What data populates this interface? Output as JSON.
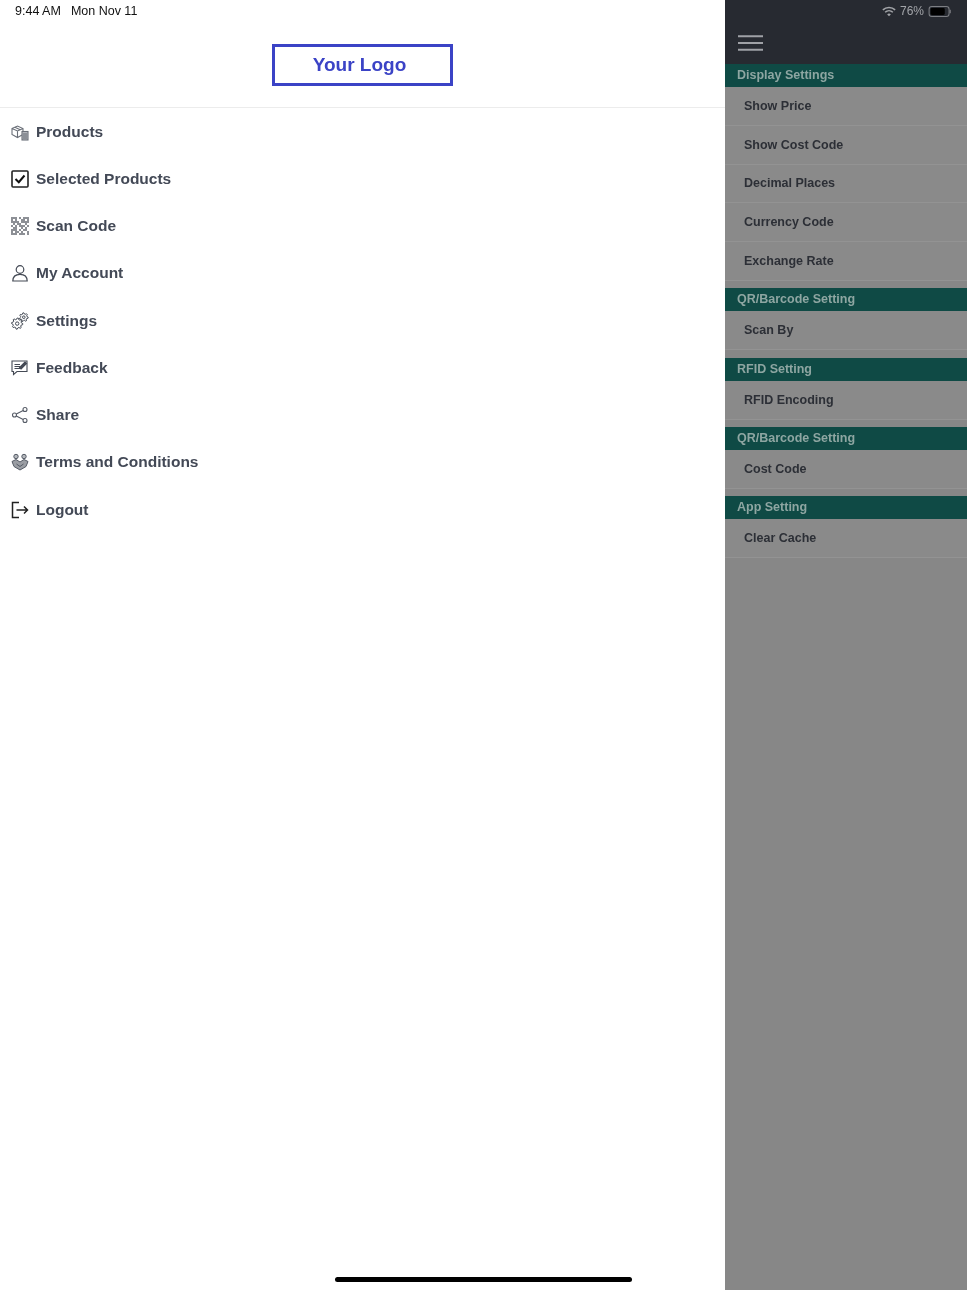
{
  "status_bar": {
    "time": "9:44 AM",
    "date": "Mon Nov 11",
    "battery": "76%"
  },
  "drawer": {
    "logo": "Your Logo",
    "items": [
      "Products",
      "Selected Products",
      "Scan Code",
      "My Account",
      "Settings",
      "Feedback",
      "Share",
      "Terms and Conditions",
      "Logout"
    ]
  },
  "settings_screen": {
    "sections": [
      {
        "title": "Display Settings",
        "items": [
          "Show Price",
          "Show Cost Code",
          "Decimal Places",
          "Currency Code",
          "Exchange Rate"
        ]
      },
      {
        "title": "QR/Barcode Setting",
        "items": [
          "Scan By"
        ]
      },
      {
        "title": "RFID Setting",
        "items": [
          "RFID Encoding"
        ]
      },
      {
        "title": "QR/Barcode Setting",
        "items": [
          "Cost Code"
        ]
      },
      {
        "title": "App Setting",
        "items": [
          "Clear Cache"
        ]
      }
    ]
  }
}
